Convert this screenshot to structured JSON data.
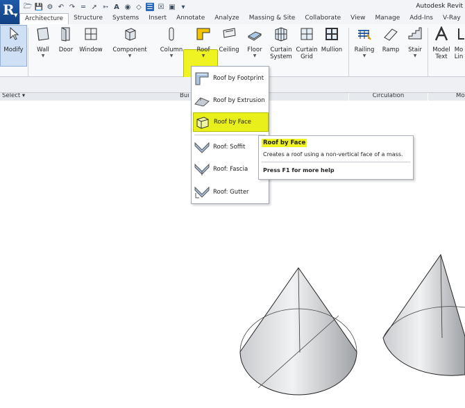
{
  "window": {
    "title": "Autodesk Revit"
  },
  "app_menu": {
    "logo": "R"
  },
  "tabs": [
    "Architecture",
    "Structure",
    "Systems",
    "Insert",
    "Annotate",
    "Analyze",
    "Massing & Site",
    "Collaborate",
    "View",
    "Manage",
    "Add-Ins",
    "V-Ray"
  ],
  "ribbon": {
    "tools": {
      "modify": "Modify",
      "wall": "Wall",
      "door": "Door",
      "window": "Window",
      "component": "Component",
      "column": "Column",
      "roof": "Roof",
      "ceiling": "Ceiling",
      "floor": "Floor",
      "curtain_system": "Curtain System",
      "curtain_grid": "Curtain Grid",
      "mullion": "Mullion",
      "railing": "Railing",
      "ramp": "Ramp",
      "stair": "Stair",
      "model_text": "Model Text",
      "model_line": "Mo Lin"
    },
    "panels": {
      "select": "Select ▾",
      "build": "Bui",
      "circulation": "Circulation",
      "model": "Mo"
    }
  },
  "roof_dropdown": {
    "items": [
      "Roof by Footprint",
      "Roof by Extrusion",
      "Roof by Face",
      "Roof: Soffit",
      "Roof: Fascia",
      "Roof: Gutter"
    ]
  },
  "tooltip": {
    "title": "Roof by Face",
    "description": "Creates a roof using a non-vertical face of a mass.",
    "help": "Press F1 for more help"
  },
  "colors": {
    "highlight": "#eef321",
    "accent": "#2b6ab8",
    "ribbon_bg": "#f8f9fb"
  }
}
